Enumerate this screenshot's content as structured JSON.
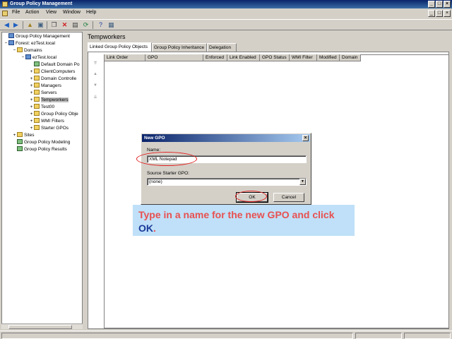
{
  "window": {
    "title": "Group Policy Management",
    "min": "_",
    "max": "□",
    "close": "×"
  },
  "menu": {
    "items": [
      "File",
      "Action",
      "View",
      "Window",
      "Help"
    ],
    "mdi_min": "_",
    "mdi_max": "□",
    "mdi_close": "×"
  },
  "tree": {
    "nodes": [
      {
        "label": "Group Policy Management",
        "expander": "",
        "icon": "gpm",
        "indent": 0
      },
      {
        "label": "Forest: ezTest.local",
        "expander": "−",
        "icon": "domain",
        "indent": 1
      },
      {
        "label": "Domains",
        "expander": "−",
        "icon": "folder",
        "indent": 2
      },
      {
        "label": "ezTest.local",
        "expander": "−",
        "icon": "domain",
        "indent": 3
      },
      {
        "label": "Default Domain Po",
        "expander": "",
        "icon": "gpo",
        "indent": 4
      },
      {
        "label": "ClientComputers",
        "expander": "+",
        "icon": "folder",
        "indent": 4
      },
      {
        "label": "Domain Controlle",
        "expander": "+",
        "icon": "folder",
        "indent": 4
      },
      {
        "label": "Managers",
        "expander": "+",
        "icon": "folder",
        "indent": 4
      },
      {
        "label": "Servers",
        "expander": "+",
        "icon": "folder",
        "indent": 4
      },
      {
        "label": "Tempworkers",
        "expander": "+",
        "icon": "folder",
        "indent": 4,
        "selected": true
      },
      {
        "label": "Test00",
        "expander": "+",
        "icon": "folder",
        "indent": 4
      },
      {
        "label": "Group Policy Obje",
        "expander": "+",
        "icon": "folder",
        "indent": 4
      },
      {
        "label": "WMI Filters",
        "expander": "+",
        "icon": "folder",
        "indent": 4
      },
      {
        "label": "Starter GPOs",
        "expander": "+",
        "icon": "folder",
        "indent": 4
      },
      {
        "label": "Sites",
        "expander": "+",
        "icon": "folder",
        "indent": 2
      },
      {
        "label": "Group Policy Modeling",
        "expander": "",
        "icon": "gpo",
        "indent": 2
      },
      {
        "label": "Group Policy Results",
        "expander": "",
        "icon": "gpo",
        "indent": 2
      }
    ]
  },
  "right": {
    "heading": "Tempworkers",
    "tabs": [
      "Linked Group Policy Objects",
      "Group Policy Inheritance",
      "Delegation"
    ],
    "columns": [
      "Link Order",
      "GPO",
      "Enforced",
      "Link Enabled",
      "GPO Status",
      "WMI Filter",
      "Modified",
      "Domain"
    ]
  },
  "dialog": {
    "title": "New GPO",
    "close": "×",
    "name_label": "Name:",
    "name_value": "XML Notepad",
    "starter_label": "Source Starter GPO:",
    "starter_value": "(none)",
    "ok": "OK",
    "cancel": "Cancel"
  },
  "callout": {
    "text_before": "Type in a name for the new GPO and click ",
    "highlight": "OK",
    "text_after": "."
  }
}
